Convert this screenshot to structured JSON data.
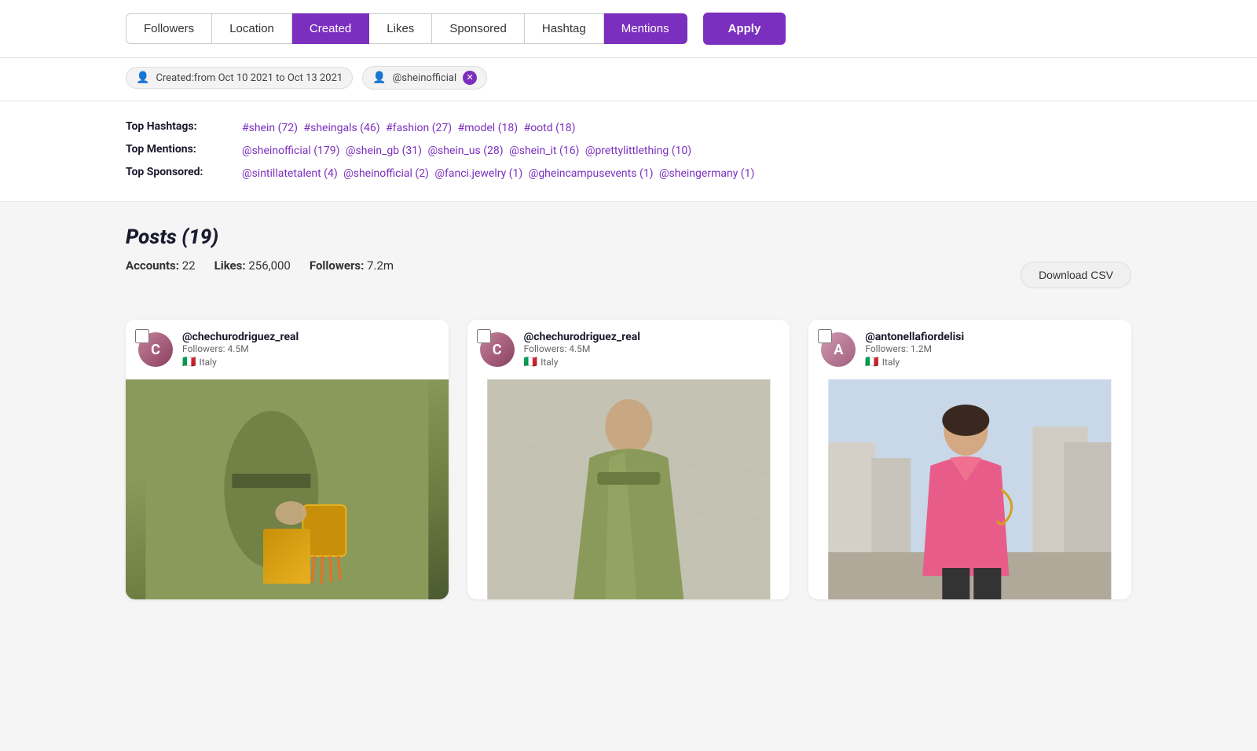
{
  "filters": {
    "buttons": [
      {
        "id": "followers",
        "label": "Followers",
        "active": false
      },
      {
        "id": "location",
        "label": "Location",
        "active": false
      },
      {
        "id": "created",
        "label": "Created",
        "active": true
      },
      {
        "id": "likes",
        "label": "Likes",
        "active": false
      },
      {
        "id": "sponsored",
        "label": "Sponsored",
        "active": false
      },
      {
        "id": "hashtag",
        "label": "Hashtag",
        "active": false
      },
      {
        "id": "mentions",
        "label": "Mentions",
        "active": true
      }
    ],
    "apply_label": "Apply"
  },
  "active_tags": [
    {
      "id": "date-range",
      "icon": "calendar",
      "text": "Created:from Oct 10 2021 to Oct 13 2021",
      "removable": false
    },
    {
      "id": "mention-tag",
      "icon": "person",
      "text": "@sheinofficial",
      "removable": true
    }
  ],
  "top_stats": {
    "hashtags_label": "Top Hashtags:",
    "hashtags_value": "#shein (72)  #sheingals (46)  #fashion (27)  #model (18)  #ootd (18)",
    "mentions_label": "Top Mentions:",
    "mentions_value": "@sheinofficial (179)  @shein_gb (31)  @shein_us (28)  @shein_it (16)  @prettylittlething (10)",
    "sponsored_label": "Top Sponsored:",
    "sponsored_value": "@sintillatetalent (4)  @sheinofficial (2)  @fanci.jewelry (1)  @gheincampusevents (1)  @sheingermany (1)"
  },
  "posts": {
    "title": "Posts (19)",
    "accounts_label": "Accounts:",
    "accounts_value": "22",
    "likes_label": "Likes:",
    "likes_value": "256,000",
    "followers_label": "Followers:",
    "followers_value": "7.2m",
    "download_csv_label": "Download CSV",
    "items": [
      {
        "id": "post-1",
        "username": "@chechurodriguez_real",
        "followers": "Followers: 4.5M",
        "country": "Italy",
        "flag": "🇮🇹",
        "avatar_initials": "C",
        "image_type": "green-dress-bag"
      },
      {
        "id": "post-2",
        "username": "@chechurodriguez_real",
        "followers": "Followers: 4.5M",
        "country": "Italy",
        "flag": "🇮🇹",
        "avatar_initials": "C",
        "image_type": "green-dress-plain"
      },
      {
        "id": "post-3",
        "username": "@antonellafiordelisi",
        "followers": "Followers: 1.2M",
        "country": "Italy",
        "flag": "🇮🇹",
        "avatar_initials": "A",
        "image_type": "pink-jacket"
      }
    ]
  },
  "colors": {
    "primary": "#7b2fbe",
    "primary_hover": "#6a1fa8",
    "text_dark": "#1a1a2e",
    "text_muted": "#666"
  }
}
